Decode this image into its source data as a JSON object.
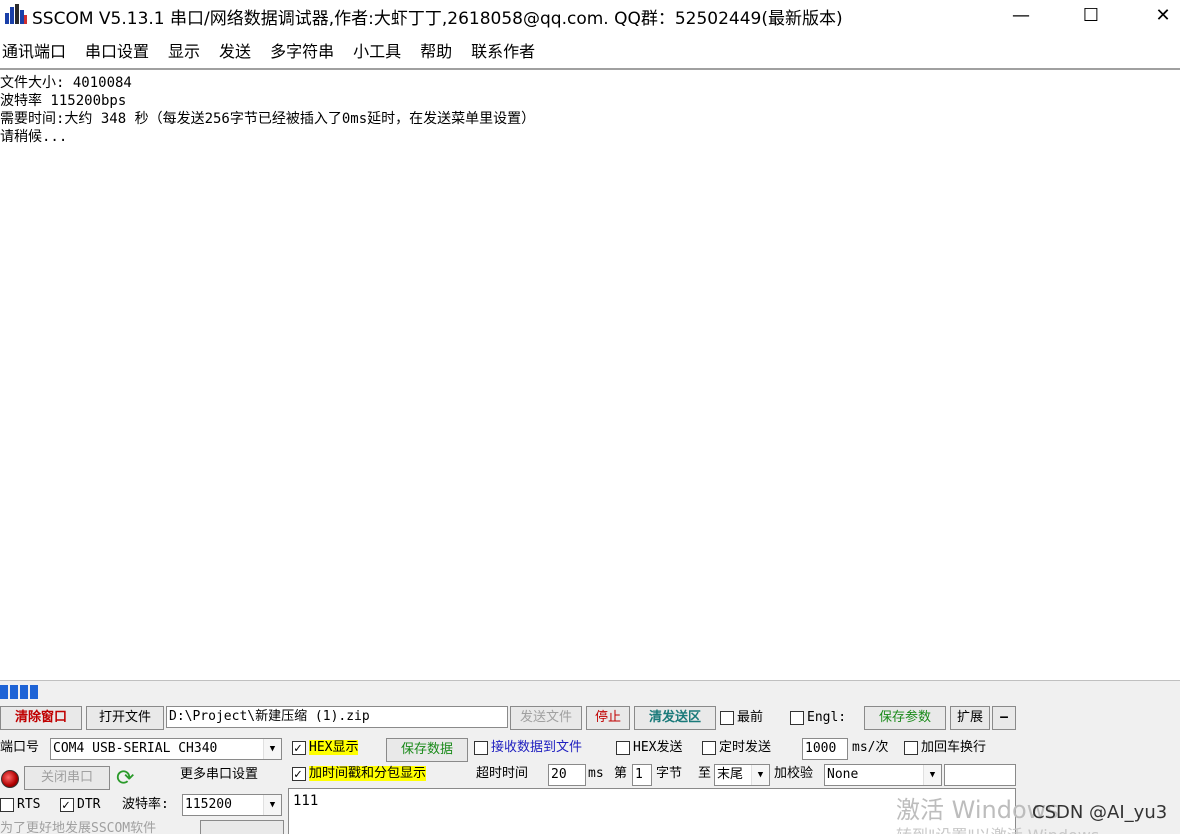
{
  "window": {
    "title": "SSCOM V5.13.1 串口/网络数据调试器,作者:大虾丁丁,2618058@qq.com. QQ群：52502449(最新版本)",
    "minimize": "—",
    "maximize": "☐",
    "close": "✕"
  },
  "menu": [
    "通讯端口",
    "串口设置",
    "显示",
    "发送",
    "多字符串",
    "小工具",
    "帮助",
    "联系作者"
  ],
  "receive": {
    "lines": [
      "文件大小: 4010084",
      "波特率 115200bps",
      "需要时间:大约 348 秒（每发送256字节已经被插入了0ms延时，在发送菜单里设置）",
      "请稍候..."
    ]
  },
  "progress": {
    "value": 0.033,
    "color": "#1e63d6"
  },
  "toolbar": {
    "clear_window": "清除窗口",
    "open_file": "打开文件",
    "file_path": "D:\\Project\\新建压缩 (1).zip",
    "send_file": "发送文件",
    "stop": "停止",
    "clear_send": "清发送区",
    "topmost": "最前",
    "english": "Engl:",
    "save_params": "保存参数",
    "expand": "扩展",
    "collapse": "—"
  },
  "port": {
    "label": "端口号",
    "value": "COM4 USB-SERIAL CH340",
    "close_port": "关闭串口",
    "more_settings": "更多串口设置",
    "rts": "RTS",
    "dtr": "DTR",
    "baud_label": "波特率:",
    "baud_value": "115200",
    "tip": "为了更好地发展SSCOM软件"
  },
  "options": {
    "hex_display": "HEX显示",
    "save_data": "保存数据",
    "recv_to_file": "接收数据到文件",
    "hex_send": "HEX发送",
    "timed_send": "定时发送",
    "interval": "1000",
    "interval_unit": "ms/次",
    "add_crlf": "加回车换行",
    "timestamp": "加时间戳和分包显示",
    "timeout_label": "超时时间",
    "timeout_value": "20",
    "timeout_unit": "ms",
    "nth_label": "第",
    "nth_value": "1",
    "byte_label": "字节",
    "to_label": "至",
    "to_value": "末尾",
    "checksum_label": "加校验",
    "checksum_value": "None"
  },
  "send": {
    "text": "111"
  },
  "overlay": {
    "activate": "激活 Windows",
    "activate_hint": "转到\"设置\"以激活 Windows",
    "csdn": "CSDN @AI_yu3"
  }
}
